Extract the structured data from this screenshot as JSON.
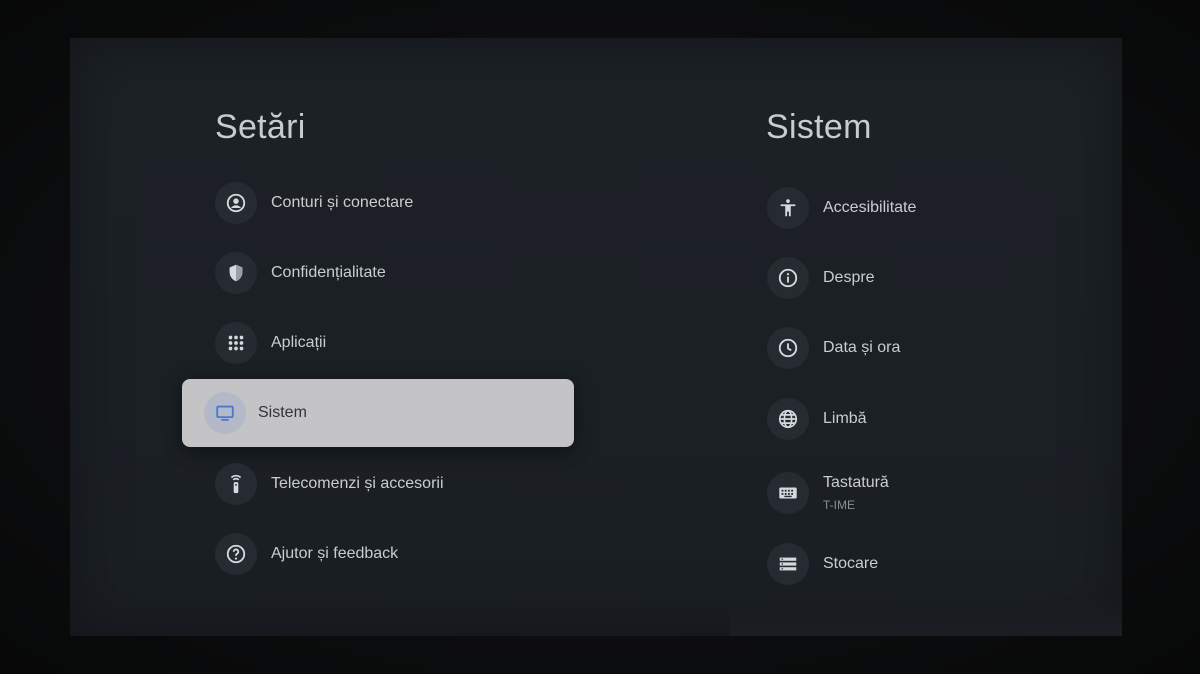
{
  "left": {
    "title": "Setări",
    "items": [
      {
        "label": "Conturi și conectare",
        "icon": "account-circle-icon"
      },
      {
        "label": "Confidențialitate",
        "icon": "shield-icon"
      },
      {
        "label": "Aplicații",
        "icon": "apps-grid-icon"
      },
      {
        "label": "Sistem",
        "icon": "tv-icon",
        "selected": true
      },
      {
        "label": "Telecomenzi și accesorii",
        "icon": "remote-icon"
      },
      {
        "label": "Ajutor și feedback",
        "icon": "help-icon"
      }
    ]
  },
  "right": {
    "title": "Sistem",
    "items": [
      {
        "label": "Accesibilitate",
        "icon": "accessibility-icon"
      },
      {
        "label": "Despre",
        "icon": "info-icon"
      },
      {
        "label": "Data și ora",
        "icon": "clock-icon"
      },
      {
        "label": "Limbă",
        "icon": "globe-icon"
      },
      {
        "label": "Tastatură",
        "sublabel": "T-IME",
        "icon": "keyboard-icon"
      },
      {
        "label": "Stocare",
        "icon": "storage-icon"
      }
    ]
  },
  "colors": {
    "background": "#1b2025",
    "text": "#c9ccd1",
    "selected_bg": "#c4c4c6",
    "selected_icon": "#4a78d6"
  }
}
